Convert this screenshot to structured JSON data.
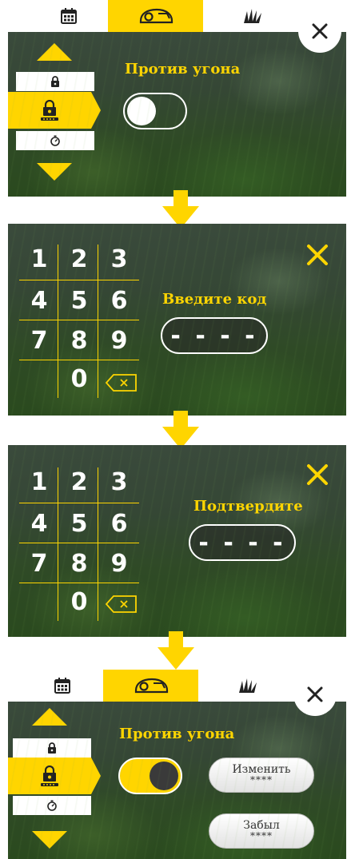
{
  "step1": {
    "tabs": [
      "calendar-icon",
      "mower-icon",
      "grass-icon"
    ],
    "active_tab": 1,
    "title": "Против угона",
    "modes": [
      "padlock-icon",
      "padlock-code-icon",
      "timer-icon"
    ],
    "toggle_on": false
  },
  "step2": {
    "title": "Введите код",
    "code": "- - - -",
    "keys": [
      "1",
      "2",
      "3",
      "4",
      "5",
      "6",
      "7",
      "8",
      "9",
      "0"
    ]
  },
  "step3": {
    "title": "Подтвердите",
    "code": "- - - -",
    "keys": [
      "1",
      "2",
      "3",
      "4",
      "5",
      "6",
      "7",
      "8",
      "9",
      "0"
    ]
  },
  "step4": {
    "tabs": [
      "calendar-icon",
      "mower-icon",
      "grass-icon"
    ],
    "active_tab": 1,
    "title": "Против угона",
    "modes": [
      "padlock-icon",
      "padlock-code-icon",
      "timer-icon"
    ],
    "toggle_on": true,
    "change_button": {
      "label": "Изменить",
      "value": "****"
    },
    "forgot_button": {
      "label": "Забыл",
      "value": "****"
    }
  },
  "colors": {
    "accent": "#ffd500",
    "grass": "#2f4a26"
  }
}
